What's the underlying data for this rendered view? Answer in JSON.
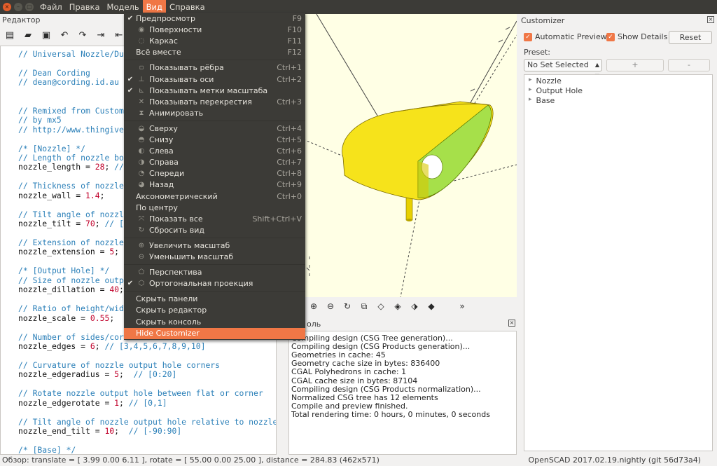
{
  "menubar": {
    "window_controls": [
      {
        "name": "close-window-button",
        "glyph": "×",
        "kind": "close"
      },
      {
        "name": "minimize-window-button",
        "glyph": "–",
        "kind": "min"
      },
      {
        "name": "maximize-window-button",
        "glyph": "▢",
        "kind": "max"
      }
    ],
    "items": [
      {
        "label": "Файл",
        "active": false
      },
      {
        "label": "Правка",
        "active": false
      },
      {
        "label": "Модель",
        "active": false
      },
      {
        "label": "Вид",
        "active": true
      },
      {
        "label": "Справка",
        "active": false
      }
    ]
  },
  "editor": {
    "title": "Редактор",
    "toolbar_icons": [
      "new-file-icon",
      "open-file-icon",
      "save-file-icon",
      "undo-icon",
      "redo-icon",
      "indent-icon",
      "unindent-icon"
    ],
    "code_lines": [
      {
        "text": "// Universal Nozzle/Du",
        "type": "comment"
      },
      {
        "text": "",
        "type": "blank"
      },
      {
        "text": "// Dean Cording",
        "type": "comment"
      },
      {
        "text": "// dean@cording.id.au",
        "type": "comment"
      },
      {
        "text": "",
        "type": "blank"
      },
      {
        "text": "",
        "type": "blank"
      },
      {
        "text": "// Remixed from Custom",
        "type": "comment"
      },
      {
        "text": "// by mx5",
        "type": "comment"
      },
      {
        "text": "// http://www.thingive",
        "type": "comment"
      },
      {
        "text": "",
        "type": "blank"
      },
      {
        "text": "/* [Nozzle] */",
        "type": "comment"
      },
      {
        "text": "// Length of nozzle bo",
        "type": "comment"
      },
      {
        "text": "nozzle_length = 28; //",
        "type": "code",
        "var": "nozzle_length",
        "num": "28",
        "rest": "//"
      },
      {
        "text": "",
        "type": "blank"
      },
      {
        "text": "// Thickness of nozzle",
        "type": "comment"
      },
      {
        "text": "nozzle_wall = 1.4;",
        "type": "code",
        "var": "nozzle_wall",
        "num": "1.4",
        "rest": ""
      },
      {
        "text": "",
        "type": "blank"
      },
      {
        "text": "// Tilt angle of nozzl",
        "type": "comment"
      },
      {
        "text": "nozzle_tilt = 70; // [",
        "type": "code",
        "var": "nozzle_tilt",
        "num": "70",
        "rest": "// ["
      },
      {
        "text": "",
        "type": "blank"
      },
      {
        "text": "// Extension of nozzle",
        "type": "comment"
      },
      {
        "text": "nozzle_extension = 5;",
        "type": "code",
        "var": "nozzle_extension",
        "num": "5",
        "rest": ""
      },
      {
        "text": "",
        "type": "blank"
      },
      {
        "text": "/* [Output Hole] */",
        "type": "comment"
      },
      {
        "text": "// Size of nozzle outp",
        "type": "comment"
      },
      {
        "text": "nozzle_dillation = 40;",
        "type": "code",
        "var": "nozzle_dillation",
        "num": "40",
        "rest": ""
      },
      {
        "text": "",
        "type": "blank"
      },
      {
        "text": "// Ratio of height/wid",
        "type": "comment"
      },
      {
        "text": "nozzle_scale = 0.55;",
        "type": "code",
        "var": "nozzle_scale",
        "num": "0.55",
        "rest": ""
      },
      {
        "text": "",
        "type": "blank"
      },
      {
        "text": "// Number of sides/cor",
        "type": "comment"
      },
      {
        "text": "nozzle_edges = 6; // [3,4,5,6,7,8,9,10]",
        "type": "code",
        "var": "nozzle_edges",
        "num": "6",
        "rest": "// [3,4,5,6,7,8,9,10]"
      },
      {
        "text": "",
        "type": "blank"
      },
      {
        "text": "// Curvature of nozzle output hole corners",
        "type": "comment"
      },
      {
        "text": "nozzle_edgeradius = 5;  // [0:20]",
        "type": "code",
        "var": "nozzle_edgeradius",
        "num": "5",
        "rest": " // [0:20]"
      },
      {
        "text": "",
        "type": "blank"
      },
      {
        "text": "// Rotate nozzle output hole between flat or corner",
        "type": "comment"
      },
      {
        "text": "nozzle_edgerotate = 1; // [0,1]",
        "type": "code",
        "var": "nozzle_edgerotate",
        "num": "1",
        "rest": "// [0,1]"
      },
      {
        "text": "",
        "type": "blank"
      },
      {
        "text": "// Tilt angle of nozzle output hole relative to nozzle",
        "type": "comment"
      },
      {
        "text": "nozzle_end_tilt = 10;  // [-90:90]",
        "type": "code",
        "var": "nozzle_end_tilt",
        "num": "10",
        "rest": " // [-90:90]"
      },
      {
        "text": "",
        "type": "blank"
      },
      {
        "text": "/* [Base] */",
        "type": "comment"
      }
    ]
  },
  "view_menu": {
    "items": [
      {
        "label": "Предпросмотр",
        "shortcut": "F9",
        "checked": true,
        "icon": "",
        "sep_after": false
      },
      {
        "label": "Поверхности",
        "shortcut": "F10",
        "checked": false,
        "icon": "surfaces-icon",
        "glyph": "◉",
        "sep_after": false
      },
      {
        "label": "Каркас",
        "shortcut": "F11",
        "checked": false,
        "icon": "wireframe-icon",
        "glyph": "◌",
        "sep_after": false
      },
      {
        "label": "Всё вместе",
        "shortcut": "F12",
        "checked": false,
        "icon": "",
        "sep_after": true
      },
      {
        "label": "Показывать рёбра",
        "shortcut": "Ctrl+1",
        "checked": false,
        "icon": "show-edges-icon",
        "glyph": "▫",
        "sep_after": false
      },
      {
        "label": "Показывать оси",
        "shortcut": "Ctrl+2",
        "checked": true,
        "icon": "show-axes-icon",
        "glyph": "⊥",
        "sep_after": false
      },
      {
        "label": "Показывать метки масштаба",
        "shortcut": "",
        "checked": true,
        "icon": "scale-markers-icon",
        "glyph": "⊾",
        "sep_after": false
      },
      {
        "label": "Показывать перекрестия",
        "shortcut": "Ctrl+3",
        "checked": false,
        "icon": "crosshairs-icon",
        "glyph": "✕",
        "sep_after": false
      },
      {
        "label": "Анимировать",
        "shortcut": "",
        "checked": false,
        "icon": "animate-icon",
        "glyph": "⧗",
        "sep_after": true
      },
      {
        "label": "Сверху",
        "shortcut": "Ctrl+4",
        "checked": false,
        "icon": "view-top-icon",
        "glyph": "◒",
        "sep_after": false
      },
      {
        "label": "Снизу",
        "shortcut": "Ctrl+5",
        "checked": false,
        "icon": "view-bottom-icon",
        "glyph": "◓",
        "sep_after": false
      },
      {
        "label": "Слева",
        "shortcut": "Ctrl+6",
        "checked": false,
        "icon": "view-left-icon",
        "glyph": "◐",
        "sep_after": false
      },
      {
        "label": "Справа",
        "shortcut": "Ctrl+7",
        "checked": false,
        "icon": "view-right-icon",
        "glyph": "◑",
        "sep_after": false
      },
      {
        "label": "Спереди",
        "shortcut": "Ctrl+8",
        "checked": false,
        "icon": "view-front-icon",
        "glyph": "◔",
        "sep_after": false
      },
      {
        "label": "Назад",
        "shortcut": "Ctrl+9",
        "checked": false,
        "icon": "view-back-icon",
        "glyph": "◕",
        "sep_after": false
      },
      {
        "label": "Аксонометрический",
        "shortcut": "Ctrl+0",
        "checked": false,
        "icon": "",
        "sep_after": false
      },
      {
        "label": "По центру",
        "shortcut": "",
        "checked": false,
        "icon": "",
        "sep_after": false
      },
      {
        "label": "Показать все",
        "shortcut": "Shift+Ctrl+V",
        "checked": false,
        "icon": "view-all-icon",
        "glyph": "⤧",
        "sep_after": false
      },
      {
        "label": "Сбросить вид",
        "shortcut": "",
        "checked": false,
        "icon": "reset-view-icon",
        "glyph": "↻",
        "sep_after": true
      },
      {
        "label": "Увеличить масштаб",
        "shortcut": "",
        "checked": false,
        "icon": "zoom-in-icon",
        "glyph": "⊕",
        "sep_after": false
      },
      {
        "label": "Уменьшить масштаб",
        "shortcut": "",
        "checked": false,
        "icon": "zoom-out-icon",
        "glyph": "⊖",
        "sep_after": true
      },
      {
        "label": "Перспектива",
        "shortcut": "",
        "checked": false,
        "icon": "perspective-icon",
        "glyph": "⬠",
        "sep_after": false
      },
      {
        "label": "Ортогональная проекция",
        "shortcut": "",
        "checked": true,
        "icon": "orthogonal-icon",
        "glyph": "⬡",
        "sep_after": true
      },
      {
        "label": "Скрыть панели",
        "shortcut": "",
        "checked": false,
        "icon": "",
        "sep_after": false
      },
      {
        "label": "Скрыть редактор",
        "shortcut": "",
        "checked": false,
        "icon": "",
        "sep_after": false
      },
      {
        "label": "Скрыть консоль",
        "shortcut": "",
        "checked": false,
        "icon": "",
        "sep_after": false
      },
      {
        "label": "Hide Customizer",
        "shortcut": "",
        "checked": false,
        "icon": "",
        "highlighted": true,
        "sep_after": false
      }
    ]
  },
  "view_toolbar_icons": [
    {
      "name": "view-all-button-icon",
      "glyph": "⬚"
    },
    {
      "name": "zoom-in-button-icon",
      "glyph": "⊕"
    },
    {
      "name": "zoom-out-button-icon",
      "glyph": "⊖"
    },
    {
      "name": "reset-view-button-icon",
      "glyph": "↻"
    },
    {
      "name": "view-right-button-icon",
      "glyph": "⧉"
    },
    {
      "name": "view-top-button-icon",
      "glyph": "◇"
    },
    {
      "name": "view-bottom-button-icon",
      "glyph": "◈"
    },
    {
      "name": "view-left-button-icon",
      "glyph": "⬗"
    },
    {
      "name": "view-front-button-icon",
      "glyph": "◆"
    },
    {
      "name": "toolbar-overflow-icon",
      "glyph": "»"
    }
  ],
  "console": {
    "title": "оль",
    "close_glyph": "×",
    "lines": [
      "Compiling design (CSG Tree generation)...",
      "Compiling design (CSG Products generation)...",
      "Geometries in cache: 45",
      "Geometry cache size in bytes: 836400",
      "CGAL Polyhedrons in cache: 1",
      "CGAL cache size in bytes: 87104",
      "Compiling design (CSG Products normalization)...",
      "Normalized CSG tree has 12 elements",
      "Compile and preview finished.",
      "Total rendering time: 0 hours, 0 minutes, 0 seconds"
    ]
  },
  "customizer": {
    "title": "Customizer",
    "close_glyph": "×",
    "auto_preview_label": "Automatic Preview",
    "show_details_label": "Show Details",
    "reset_label": "Reset",
    "preset_label": "Preset:",
    "preset_value": "No Set Selected",
    "add_label": "+",
    "remove_label": "-",
    "groups": [
      "Nozzle",
      "Output Hole",
      "Base"
    ]
  },
  "status": {
    "left": "Обзор: translate = [ 3.99 0.00 6.11 ], rotate = [ 55.00 0.00 25.00 ], distance = 284.83 (462x571)",
    "right": "OpenSCAD 2017.02.19.nightly (git 56d73a4)"
  },
  "colors": {
    "menubar_bg": "#3c3b37",
    "accent": "#f07746",
    "viewport_bg": "#ffffe5",
    "model_yellow": "#f6e31b",
    "model_green": "#a6e04a",
    "comment": "#2a7fb8",
    "number": "#c0002a"
  }
}
